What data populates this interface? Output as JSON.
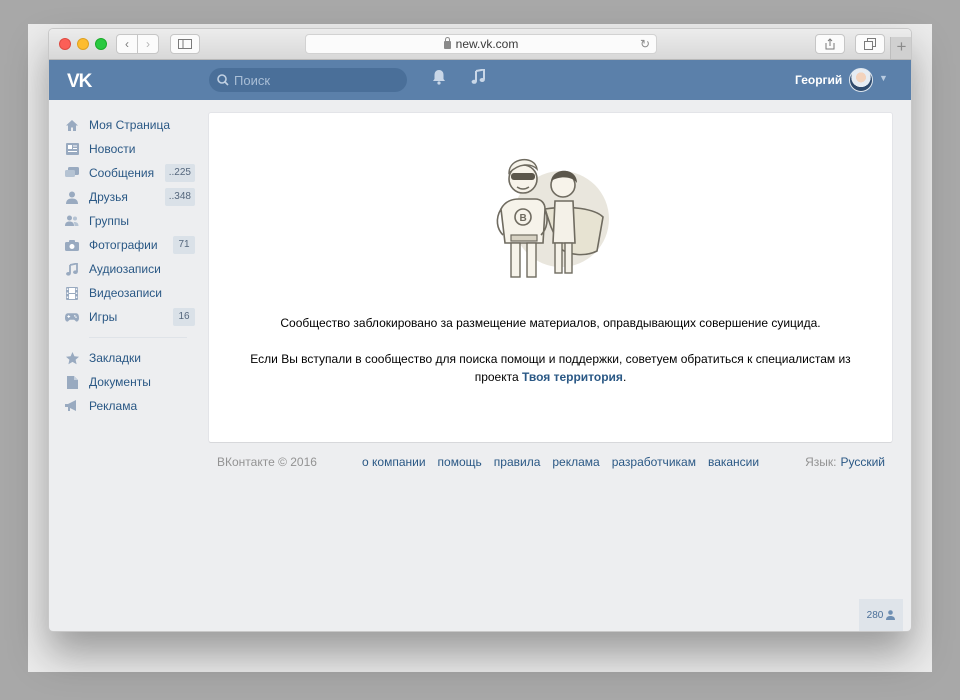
{
  "browser": {
    "url": "new.vk.com"
  },
  "header": {
    "logo": "VK",
    "search_placeholder": "Поиск",
    "user_name": "Георгий"
  },
  "sidebar": {
    "items": [
      {
        "label": "Моя Страница",
        "icon": "home-icon"
      },
      {
        "label": "Новости",
        "icon": "news-icon"
      },
      {
        "label": "Сообщения",
        "icon": "messages-icon",
        "count": "..225"
      },
      {
        "label": "Друзья",
        "icon": "friends-icon",
        "count": "..348"
      },
      {
        "label": "Группы",
        "icon": "groups-icon"
      },
      {
        "label": "Фотографии",
        "icon": "camera-icon",
        "count": "71"
      },
      {
        "label": "Аудиозаписи",
        "icon": "music-icon"
      },
      {
        "label": "Видеозаписи",
        "icon": "film-icon"
      },
      {
        "label": "Игры",
        "icon": "gamepad-icon",
        "count": "16"
      }
    ],
    "secondary": [
      {
        "label": "Закладки",
        "icon": "star-icon"
      },
      {
        "label": "Документы",
        "icon": "document-icon"
      },
      {
        "label": "Реклама",
        "icon": "megaphone-icon"
      }
    ]
  },
  "content": {
    "message_1": "Сообщество заблокировано за размещение материалов, оправдывающих совершение суицида.",
    "message_2_prefix": "Если Вы вступали в сообщество для поиска помощи и поддержки, советуем обратиться к специалистам из проекта ",
    "message_2_link": "Твоя территория",
    "message_2_suffix": "."
  },
  "footer": {
    "copyright": "ВКонтакте © 2016",
    "links": [
      "о компании",
      "помощь",
      "правила",
      "реклама",
      "разработчикам",
      "вакансии"
    ],
    "language_label": "Язык:",
    "language_value": "Русский"
  },
  "online_count": "280",
  "colors": {
    "vk_blue": "#5b80aa",
    "link": "#2a5885",
    "background": "#edeef0"
  }
}
